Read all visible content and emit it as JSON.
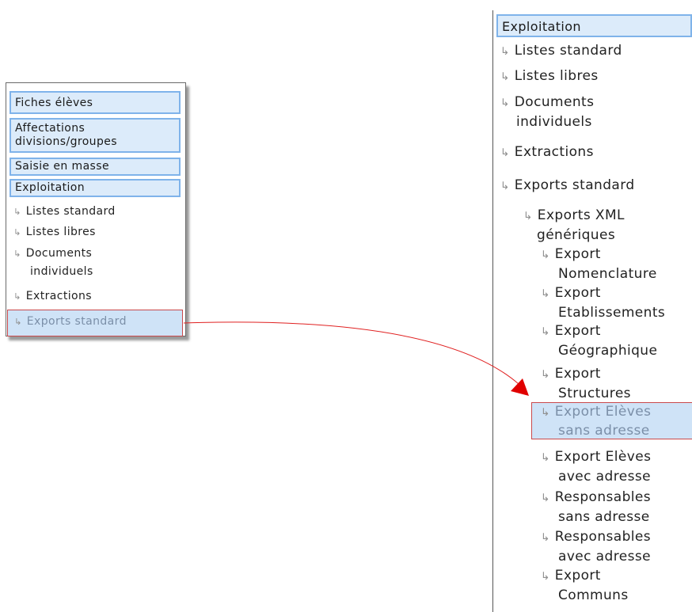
{
  "left_menu": {
    "headers": [
      "Fiches élèves",
      "Affectations divisions/groupes",
      "Saisie en masse",
      "Exploitation"
    ],
    "header_line2": "divisions/groupes",
    "items": [
      "Listes standard",
      "Listes libres",
      "Documents",
      "individuels",
      "Extractions",
      "Exports standard"
    ]
  },
  "right_menu": {
    "header": "Exploitation",
    "items": {
      "listes_standard": "Listes standard",
      "listes_libres": "Listes libres",
      "documents": "Documents",
      "individuels": "individuels",
      "extractions": "Extractions",
      "exports_standard": "Exports standard",
      "xml_1": "Exports XML",
      "xml_2": "génériques",
      "nom_1": "Export",
      "nom_2": "Nomenclature",
      "eta_1": "Export",
      "eta_2": "Etablissements",
      "geo_1": "Export",
      "geo_2": "Géographique",
      "str_1": "Export",
      "str_2": "Structures",
      "esa_1": "Export Elèves",
      "esa_2": "sans adresse",
      "eaa_1": "Export Elèves",
      "eaa_2": "avec adresse",
      "rsa_1": "Responsables",
      "rsa_2": "sans adresse",
      "raa_1": "Responsables",
      "raa_2": "avec adresse",
      "com_1": "Export",
      "com_2": "Communs"
    }
  },
  "icons": {
    "item_arrow": "sub-item-arrow-icon",
    "link_arrow": "red-arrow-connector"
  },
  "colors": {
    "header_bg": "#dcebfa",
    "header_border": "#7fb3ea",
    "selected_bg": "#cfe3f7",
    "selected_border": "#c9494b",
    "connector": "#e02020"
  }
}
